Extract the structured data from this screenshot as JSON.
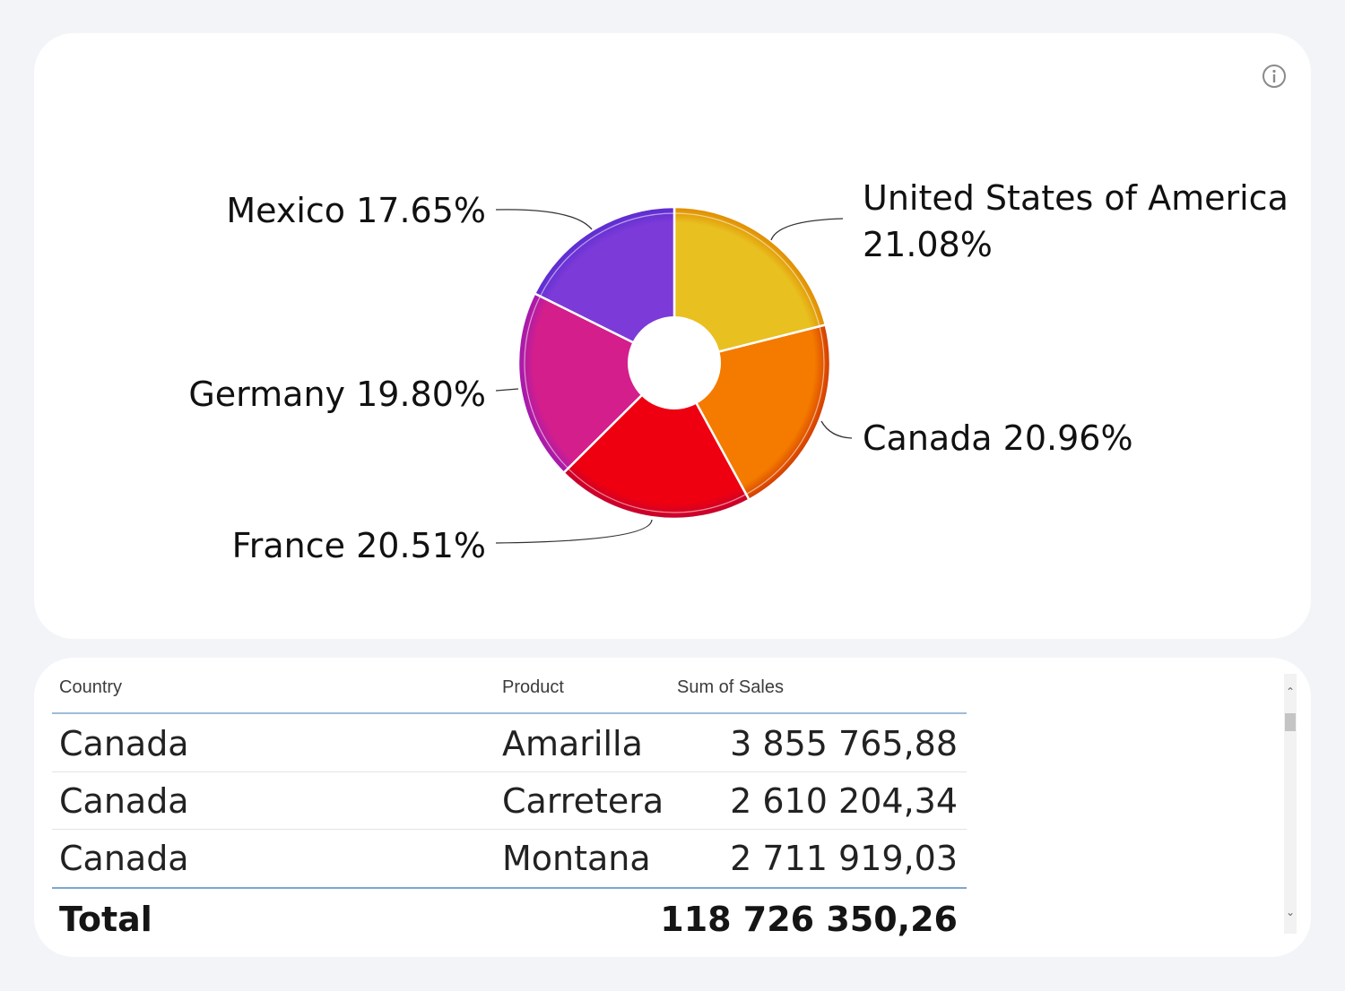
{
  "chart_data": {
    "type": "pie",
    "style": "donut",
    "title": "",
    "slices": [
      {
        "label": "United States of America",
        "value": 21.08,
        "color": "#e8c020",
        "edge": "#e08a00"
      },
      {
        "label": "Canada",
        "value": 20.96,
        "color": "#f47a00",
        "edge": "#d23a00"
      },
      {
        "label": "France",
        "value": 20.51,
        "color": "#ee0010",
        "edge": "#c40030"
      },
      {
        "label": "Germany",
        "value": 19.8,
        "color": "#d41e8c",
        "edge": "#a01ab0"
      },
      {
        "label": "Mexico",
        "value": 17.65,
        "color": "#7c3ad8",
        "edge": "#5a2cd0"
      }
    ],
    "labels": [
      {
        "line1": "United States of America",
        "line2": "21.08%"
      },
      {
        "line1": "Canada 20.96%",
        "line2": ""
      },
      {
        "line1": "France 20.51%",
        "line2": ""
      },
      {
        "line1": "Germany 19.80%",
        "line2": ""
      },
      {
        "line1": "Mexico 17.65%",
        "line2": ""
      }
    ],
    "legend": "none"
  },
  "table": {
    "columns": [
      "Country",
      "Product",
      "Sum of Sales"
    ],
    "rows": [
      [
        "Canada",
        "Amarilla",
        "3 855 765,88"
      ],
      [
        "Canada",
        "Carretera",
        "2 610 204,34"
      ],
      [
        "Canada",
        "Montana",
        "2 711 919,03"
      ]
    ],
    "total_label": "Total",
    "total_value": "118 726 350,26"
  },
  "scrollbar": {
    "up_glyph": "⌃",
    "down_glyph": "⌄"
  }
}
